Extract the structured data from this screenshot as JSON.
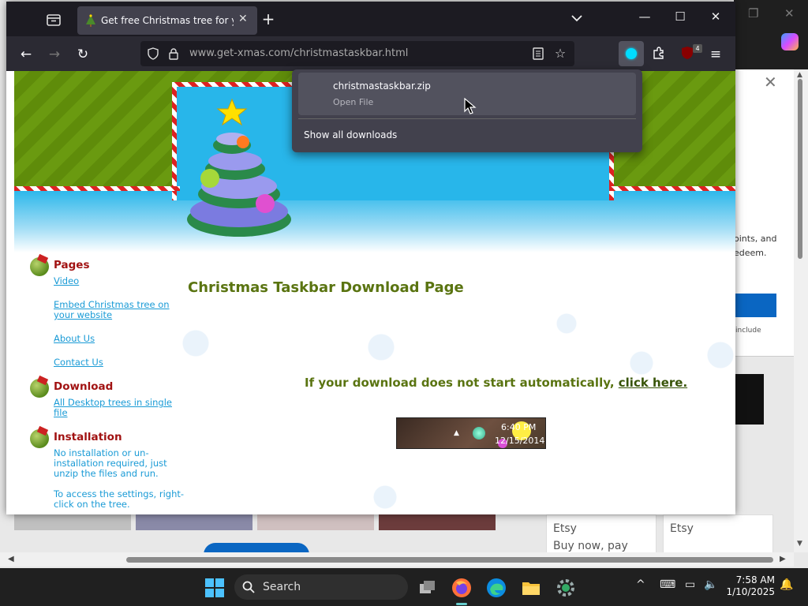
{
  "browser": {
    "tab": {
      "title": "Get free Christmas tree for your desktop"
    },
    "url": {
      "host": "www.get-xmas.com",
      "path": "/christmastaskbar.html"
    },
    "badge_count": "4"
  },
  "downloads_panel": {
    "filename": "christmastaskbar.zip",
    "status": "Open File",
    "show_all": "Show all downloads"
  },
  "page": {
    "title": "Christmas Taskbar Download Page",
    "download_msg": "If your download does not start automatically,",
    "download_link": "click here.",
    "preview": {
      "time": "6:40 PM",
      "date": "12/15/2014"
    },
    "sidebar": {
      "pages_heading": "Pages",
      "pages_links": [
        "Video",
        "Embed Christmas tree on your website",
        "About Us",
        "Contact Us"
      ],
      "download_heading": "Download",
      "download_link": "All Desktop trees in single file",
      "install_heading": "Installation",
      "install_text1": "No installation or un-installation required, just unzip the files and run.",
      "install_text2": "To access the settings, right-click on the tree."
    }
  },
  "background_page": {
    "text1": "oints, and",
    "text2": "edeem.",
    "text3": "include",
    "etsy1_name": "Etsy",
    "etsy1_sub": "Buy now, pay later",
    "etsy2_name": "Etsy"
  },
  "taskbar": {
    "search_label": "Search",
    "time": "7:58 AM",
    "date": "1/10/2025"
  },
  "colors": {
    "accent": "#00ddff",
    "page_green": "#5a7411",
    "link_blue": "#1a9bd6",
    "heading_red": "#a11212"
  }
}
